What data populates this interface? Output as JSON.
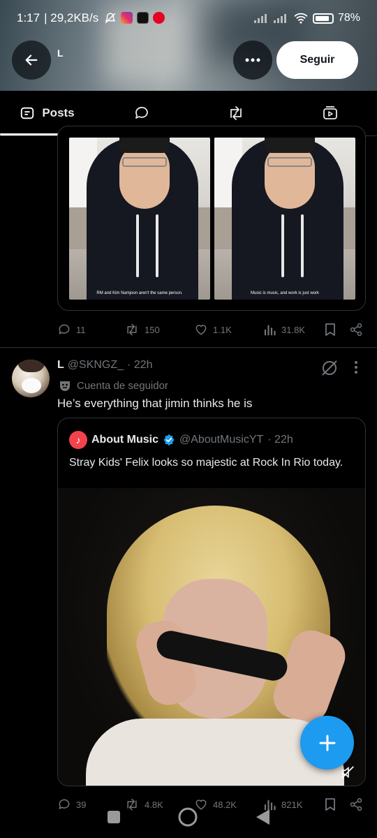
{
  "status_bar": {
    "time": "1:17",
    "network_speed": "| 29,2KB/s",
    "battery": "78%",
    "app_icons": [
      "mute-bell-icon",
      "instagram-icon",
      "tiktok-icon",
      "pinterest-icon"
    ]
  },
  "header": {
    "profile_name": "L",
    "follow_label": "Seguir"
  },
  "tabs": [
    {
      "label": "Posts",
      "icon": "posts-icon",
      "active": true
    },
    {
      "label": "",
      "icon": "replies-icon",
      "active": false
    },
    {
      "label": "",
      "icon": "reposts-icon",
      "active": false
    },
    {
      "label": "",
      "icon": "media-icon",
      "active": false
    }
  ],
  "post1": {
    "captions": [
      "RM and Kim Namjoon aren't the same person.",
      "Music is music, and work is just work"
    ],
    "replies": "11",
    "reposts": "150",
    "likes": "1.1K",
    "views": "31.8K"
  },
  "post2": {
    "name": "L",
    "handle": "@SKNGZ_",
    "time": "· 22h",
    "label": "Cuenta de seguidor",
    "text": "He’s everything that jimin thinks he is",
    "quote": {
      "name": "About Music",
      "handle": "@AboutMusicYT",
      "time": "· 22h",
      "text": "Stray Kids' Felix looks so majestic at Rock In Rio today."
    },
    "replies": "39",
    "reposts": "4.8K",
    "likes": "48.2K",
    "views": "821K"
  },
  "colors": {
    "accent": "#1d9bf0",
    "background": "#000000",
    "secondary_text": "#71767b",
    "border": "#2f3336"
  }
}
